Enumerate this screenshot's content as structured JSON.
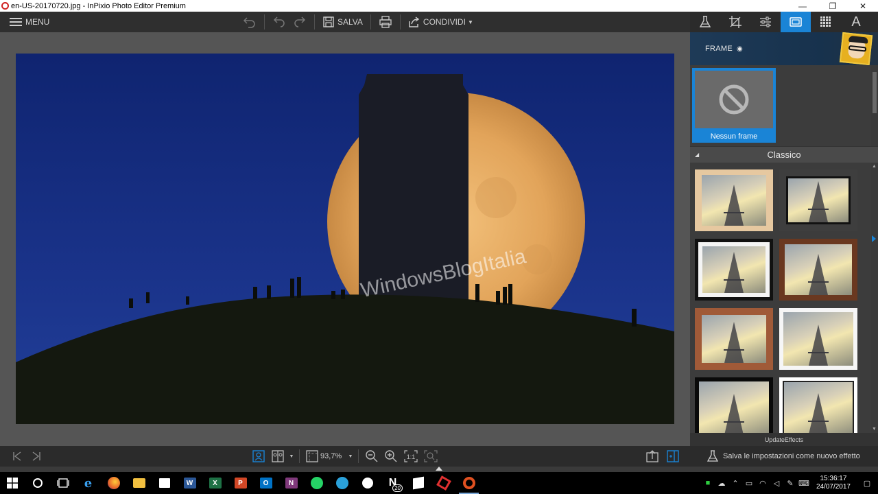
{
  "window": {
    "title": "en-US-20170720.jpg - InPixio Photo Editor Premium",
    "minimize": "—",
    "restore": "❐",
    "close": "✕"
  },
  "toolbar": {
    "menu_label": "MENU",
    "save_label": "SALVA",
    "share_label": "CONDIVIDI"
  },
  "right_tabs": [
    {
      "name": "effects-tab",
      "icon": "flask-icon"
    },
    {
      "name": "crop-tab",
      "icon": "crop-icon"
    },
    {
      "name": "adjust-tab",
      "icon": "sliders-icon"
    },
    {
      "name": "frame-tab",
      "icon": "frame-icon",
      "active": true
    },
    {
      "name": "texture-tab",
      "icon": "grid-icon"
    },
    {
      "name": "text-tab",
      "icon": "text-icon",
      "glyph": "A"
    }
  ],
  "canvas": {
    "watermark": "WindowsBlogItalia"
  },
  "frame_panel": {
    "header": "FRAME",
    "no_frame_label": "Nessun frame",
    "section_title": "Classico",
    "update_label": "UpdateEffects",
    "frames": [
      {
        "name": "frame-beige",
        "border": "#e6c8a0",
        "inner": "#d8b890"
      },
      {
        "name": "frame-dark-gray",
        "border": "#3a3a3a",
        "inner": "#222222"
      },
      {
        "name": "frame-black-white",
        "border": "#111111",
        "inner": "#f4f4f4"
      },
      {
        "name": "frame-brown",
        "border": "#6a3820",
        "inner": "#8a4a2a"
      },
      {
        "name": "frame-wood",
        "border": "#a05a38",
        "inner": "#b06a44"
      },
      {
        "name": "frame-white",
        "border": "#f4f4f4",
        "inner": "#ffffff"
      },
      {
        "name": "frame-black",
        "border": "#0a0a0a",
        "inner": "#1a1a1a"
      },
      {
        "name": "frame-white-thin",
        "border": "#ffffff",
        "inner": "#202020"
      }
    ]
  },
  "bottombar": {
    "zoom": "93,7%",
    "save_effect_label": "Salva le impostazioni come nuovo effetto"
  },
  "taskbar": {
    "time": "15:36:17",
    "date": "24/07/2017",
    "onenote_badge": "20",
    "apps": [
      {
        "name": "start-button",
        "icon": "windows-icon"
      },
      {
        "name": "search-button",
        "icon": "cortana-icon"
      },
      {
        "name": "taskview-button",
        "icon": "taskview-icon"
      },
      {
        "name": "edge-app",
        "icon": "edge-icon",
        "color": "#1f7ad6",
        "letter": "e"
      },
      {
        "name": "firefox-app",
        "icon": "firefox-icon",
        "color": "#e8662a",
        "letter": ""
      },
      {
        "name": "explorer-app",
        "icon": "folder-icon",
        "color": "#f2c040",
        "letter": ""
      },
      {
        "name": "store-app",
        "icon": "store-icon",
        "color": "#ffffff",
        "letter": ""
      },
      {
        "name": "word-app",
        "icon": "word-icon",
        "color": "#2b5797",
        "letter": "W"
      },
      {
        "name": "excel-app",
        "icon": "excel-icon",
        "color": "#1e7145",
        "letter": "X"
      },
      {
        "name": "powerpoint-app",
        "icon": "powerpoint-icon",
        "color": "#d24726",
        "letter": "P"
      },
      {
        "name": "outlook-app",
        "icon": "outlook-icon",
        "color": "#0072c6",
        "letter": "O"
      },
      {
        "name": "onenote-app",
        "icon": "onenote-icon",
        "color": "#80397b",
        "letter": "N"
      },
      {
        "name": "whatsapp-app",
        "icon": "whatsapp-icon",
        "color": "#25d366",
        "letter": ""
      },
      {
        "name": "telegram-app",
        "icon": "telegram-icon",
        "color": "#2aa1da",
        "letter": ""
      },
      {
        "name": "slack-app",
        "icon": "slack-icon",
        "color": "#ffffff",
        "letter": ""
      },
      {
        "name": "n-app",
        "icon": "n-icon",
        "color": "#ffffff",
        "letter": "N"
      },
      {
        "name": "winstore-app",
        "icon": "windows-store-icon",
        "color": "#ffffff",
        "letter": ""
      },
      {
        "name": "rpi-app",
        "icon": "rpi-icon",
        "color": "#e03030",
        "letter": ""
      },
      {
        "name": "inpixio-app",
        "icon": "inpixio-icon",
        "color": "#e05020",
        "letter": "",
        "active": true
      }
    ]
  }
}
